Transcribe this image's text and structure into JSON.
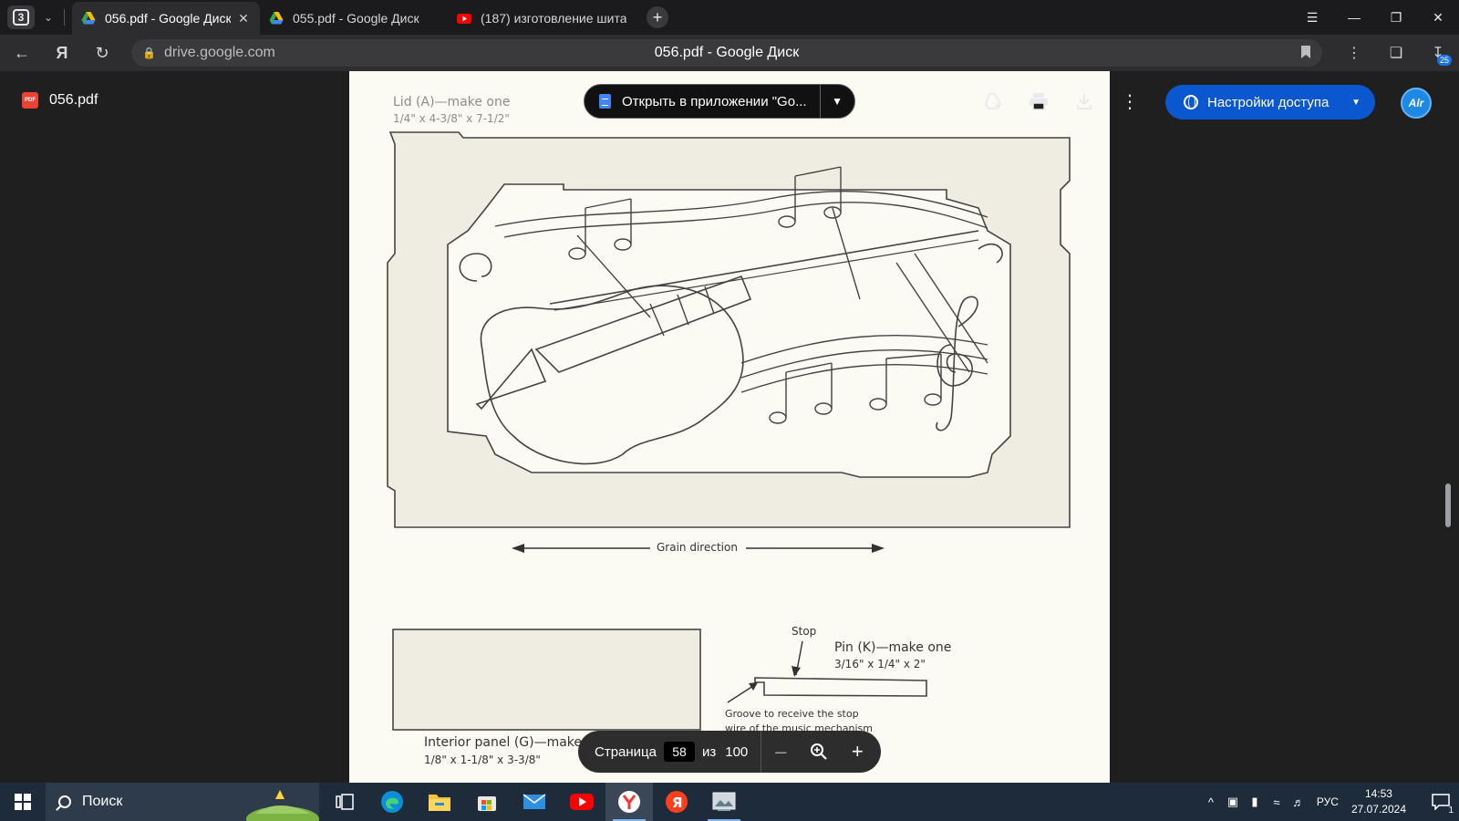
{
  "browser": {
    "tab_count": "3",
    "tabs": [
      {
        "title": "056.pdf - Google Диск",
        "active": true
      },
      {
        "title": "055.pdf - Google Диск",
        "active": false
      },
      {
        "title": "(187) изготовление шита",
        "active": false
      }
    ],
    "url": "drive.google.com",
    "page_title": "056.pdf - Google Диск",
    "download_badge": "25"
  },
  "viewer": {
    "file_name": "056.pdf",
    "file_icon_text": "PDF",
    "open_with_label": "Открыть в приложении \"Go...",
    "share_label": "Настройки доступа",
    "avatar_text": "Alr"
  },
  "pdf": {
    "lid_title": "Lid (A)—make one",
    "lid_dims": "1/4\" x 4-3/8\" x 7-1/2\"",
    "grain": "Grain direction",
    "stop": "Stop",
    "pin_title": "Pin (K)—make one",
    "pin_dims": "3/16\" x 1/4\" x 2\"",
    "groove_line1": "Groove to receive the stop",
    "groove_line2": "wire of the music mechanism",
    "panel_title": "Interior panel (G)—make one",
    "panel_dims": "1/8\" x 1-1/8\" x 3-3/8\""
  },
  "pagenav": {
    "page_label": "Страница",
    "current": "58",
    "of": "из",
    "total": "100"
  },
  "taskbar": {
    "search_label": "Поиск",
    "lang": "РУС",
    "time": "14:53",
    "date": "27.07.2024",
    "notif_count": "1"
  },
  "colors": {
    "accent": "#0b57d0",
    "pdf_bg": "#fbfbf3",
    "viewer_bg": "#1f1f1f"
  }
}
